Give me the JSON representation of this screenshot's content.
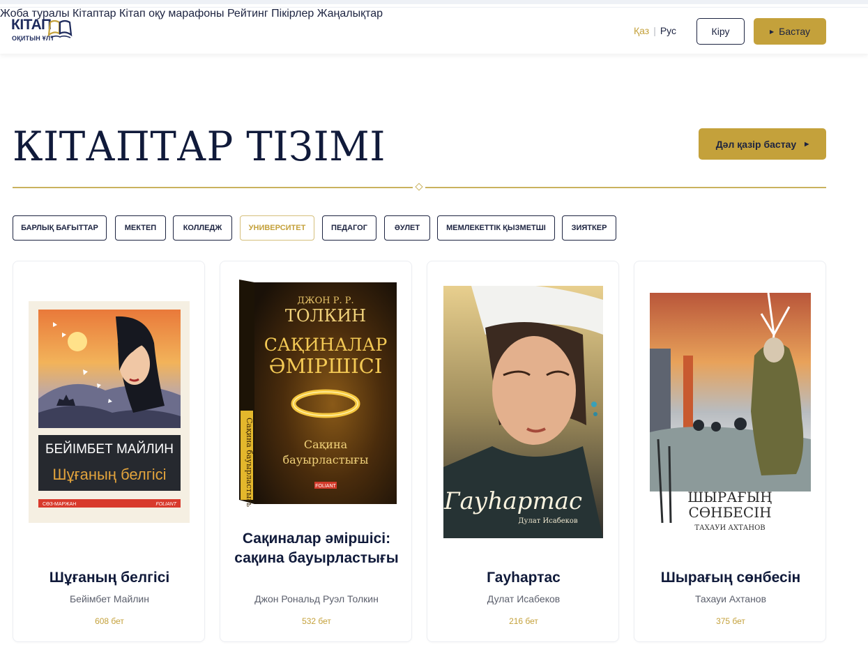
{
  "header": {
    "logo": {
      "line1": "КІТАП",
      "line2": "ОҚИТЫН ҰЛТ"
    },
    "nav": [
      {
        "label": "Жоба туралы"
      },
      {
        "label": "Кітаптар"
      },
      {
        "label": "Кітап оқу марафоны"
      },
      {
        "label": "Рейтинг"
      },
      {
        "label": "Пікірлер"
      },
      {
        "label": "Жаңалықтар"
      }
    ],
    "lang": {
      "active": "Қаз",
      "separator": "|",
      "other": "Рус"
    },
    "login_label": "Кіру",
    "start_label": "Бастау"
  },
  "main": {
    "title": "КІТАПТАР ТІЗІМІ",
    "start_now_label": "Дәл қазір бастау",
    "filters": [
      {
        "label": "БАРЛЫҚ БАҒЫТТАР",
        "active": false
      },
      {
        "label": "МЕКТЕП",
        "active": false
      },
      {
        "label": "КОЛЛЕДЖ",
        "active": false
      },
      {
        "label": "УНИВЕРСИТЕТ",
        "active": true
      },
      {
        "label": "ПЕДАГОГ",
        "active": false
      },
      {
        "label": "ӘУЛЕТ",
        "active": false
      },
      {
        "label": "МЕМЛЕКЕТТІК ҚЫЗМЕТШІ",
        "active": false
      },
      {
        "label": "ЗИЯТКЕР",
        "active": false
      }
    ],
    "books": [
      {
        "title": "Шұғаның белгісі",
        "author": "Бейімбет Майлин",
        "pages": "608 бет",
        "cover": {
          "author": "БЕЙІМБЕТ МАЙЛИН",
          "title": "Шұғаның белгісі",
          "publisher_left": "СӨЗ-МАРЖАН",
          "publisher_right": "FOLIANT"
        }
      },
      {
        "title": "Сақиналар әміршісі: сақина бауырластығы",
        "author": "Джон Рональд Руэл Толкин",
        "pages": "532 бет",
        "cover": {
          "author_small": "ДЖОН Р. Р.",
          "author_big": "ТОЛКИН",
          "title1": "САҚИНАЛАР",
          "title2": "ӘМІРШІСІ",
          "sub1": "Сақина",
          "sub2": "бауырластығы",
          "spine": "Сақина бауырластығы",
          "publisher": "FOLIANT"
        }
      },
      {
        "title": "Гауһартас",
        "author": "Дулат Исабеков",
        "pages": "216 бет",
        "cover": {
          "title": "Гауһартас",
          "author": "Дулат Исабеков"
        }
      },
      {
        "title": "Шырағың сөнбесін",
        "author": "Тахауи Ахтанов",
        "pages": "375 бет",
        "cover": {
          "title1": "ШЫРАҒЫҢ",
          "title2": "СӨНБЕСІН",
          "author": "ТАХАУИ АХТАНОВ"
        }
      }
    ]
  },
  "colors": {
    "accent": "#c4a13b",
    "navy": "#1c2340",
    "divider": "#c9b25e"
  }
}
